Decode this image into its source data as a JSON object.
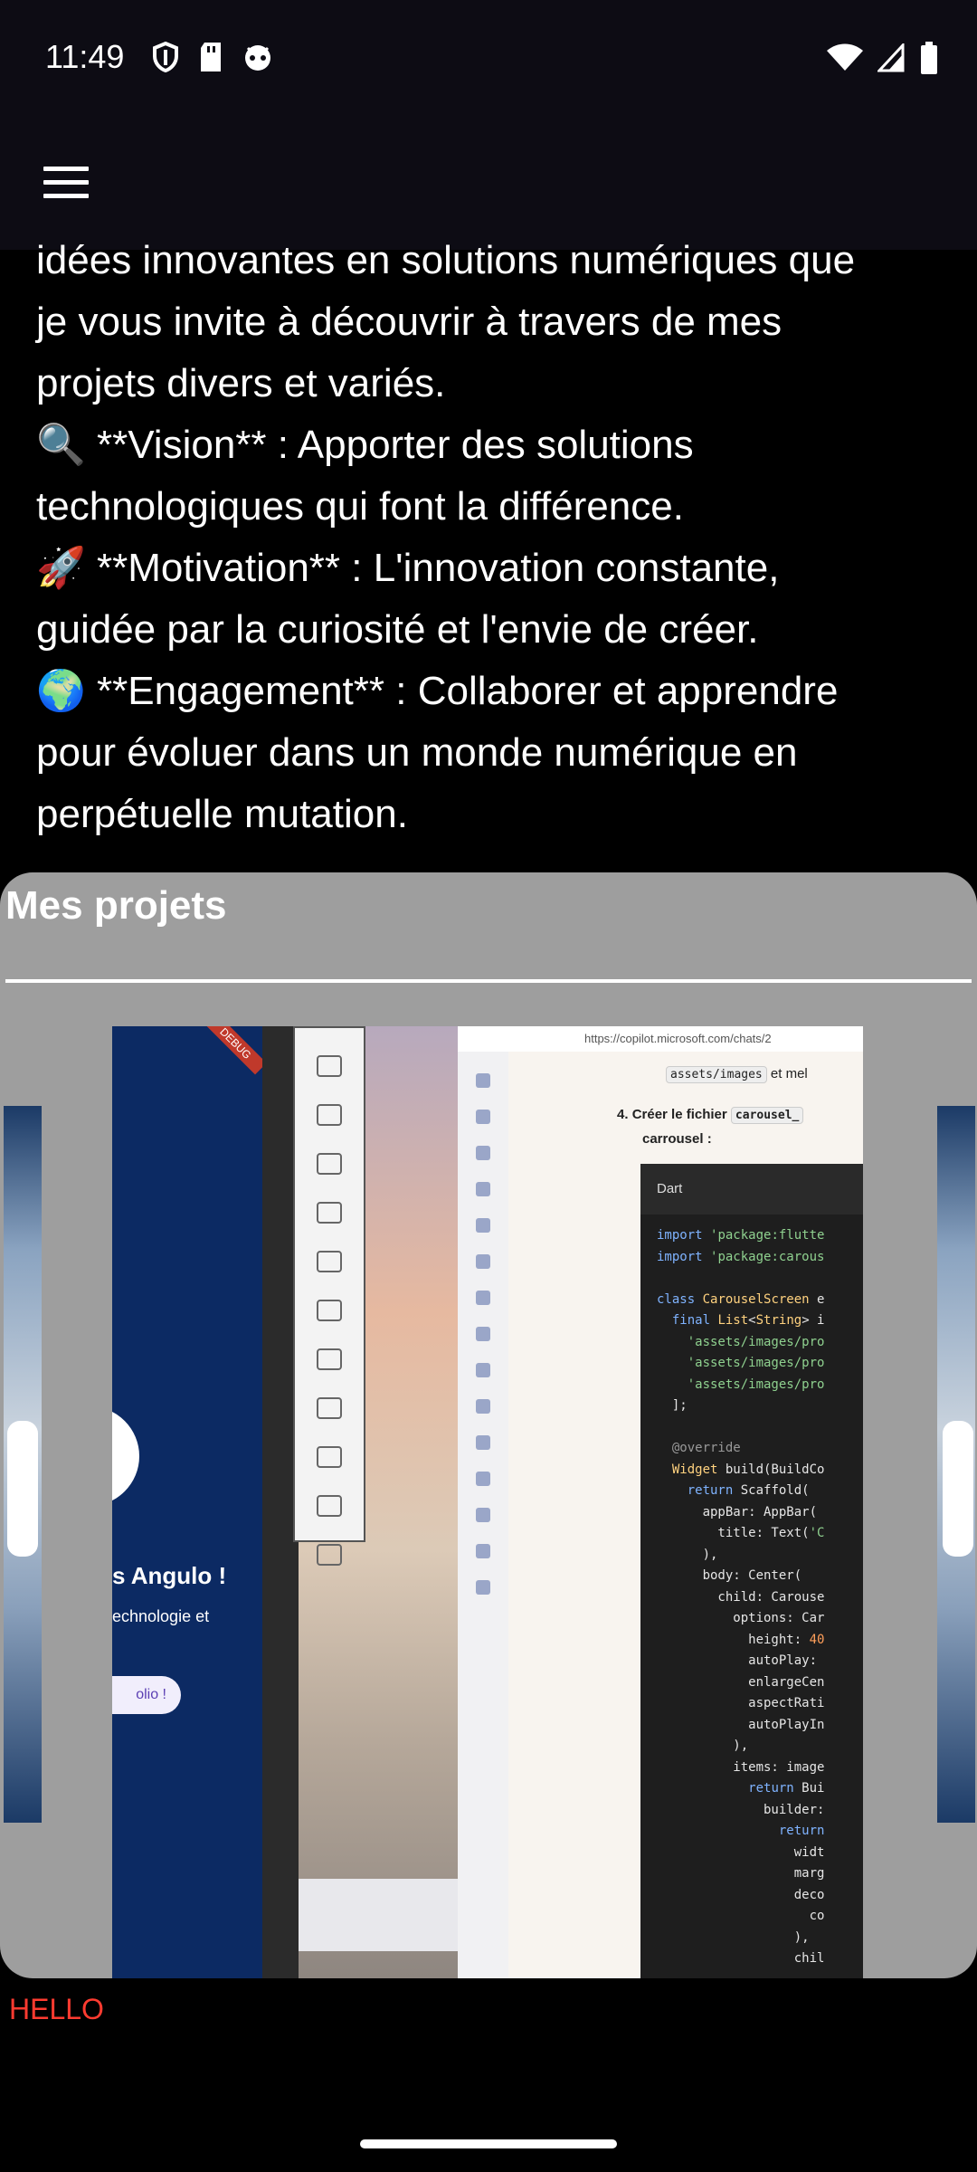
{
  "status_bar": {
    "time": "11:49",
    "left_icons": [
      "shield-icon",
      "sd-card-icon",
      "android-face-icon"
    ],
    "right_icons": [
      "wifi-icon",
      "signal-icon",
      "battery-icon"
    ]
  },
  "app_bar": {
    "menu_icon": "hamburger-menu-icon"
  },
  "intro": {
    "lines": [
      "idées innovantes en solutions numériques que",
      "je vous invite à découvrir à travers de mes",
      "projets divers et variés.",
      "🔍 **Vision** : Apporter des solutions",
      "technologiques qui font la différence.",
      "🚀 **Motivation** : L'innovation constante,",
      "guidée par la curiosité et l'envie de créer.",
      "🌍 **Engagement** : Collaborer et apprendre",
      "pour évoluer dans un monde numérique en",
      "perpétuelle mutation."
    ]
  },
  "projects": {
    "title": "Mes projets",
    "slide": {
      "phone_debug": "DEBUG",
      "phone_title": "s Angulo !",
      "phone_subtitle": "echnologie et",
      "phone_button": "olio !",
      "browser_url": "https://copilot.microsoft.com/chats/2",
      "chat_assets": "assets/images",
      "chat_assets_suffix": "et mel",
      "chat_step_number": "4.",
      "chat_step_text": "Créer le fichier",
      "chat_step_code": "carousel_",
      "chat_step_text2": "carrousel :",
      "code_lang": "Dart"
    }
  },
  "footer_text": "HELLO",
  "colors": {
    "background": "#000000",
    "card": "#9e9e9e",
    "hello": "#ff3b30"
  }
}
